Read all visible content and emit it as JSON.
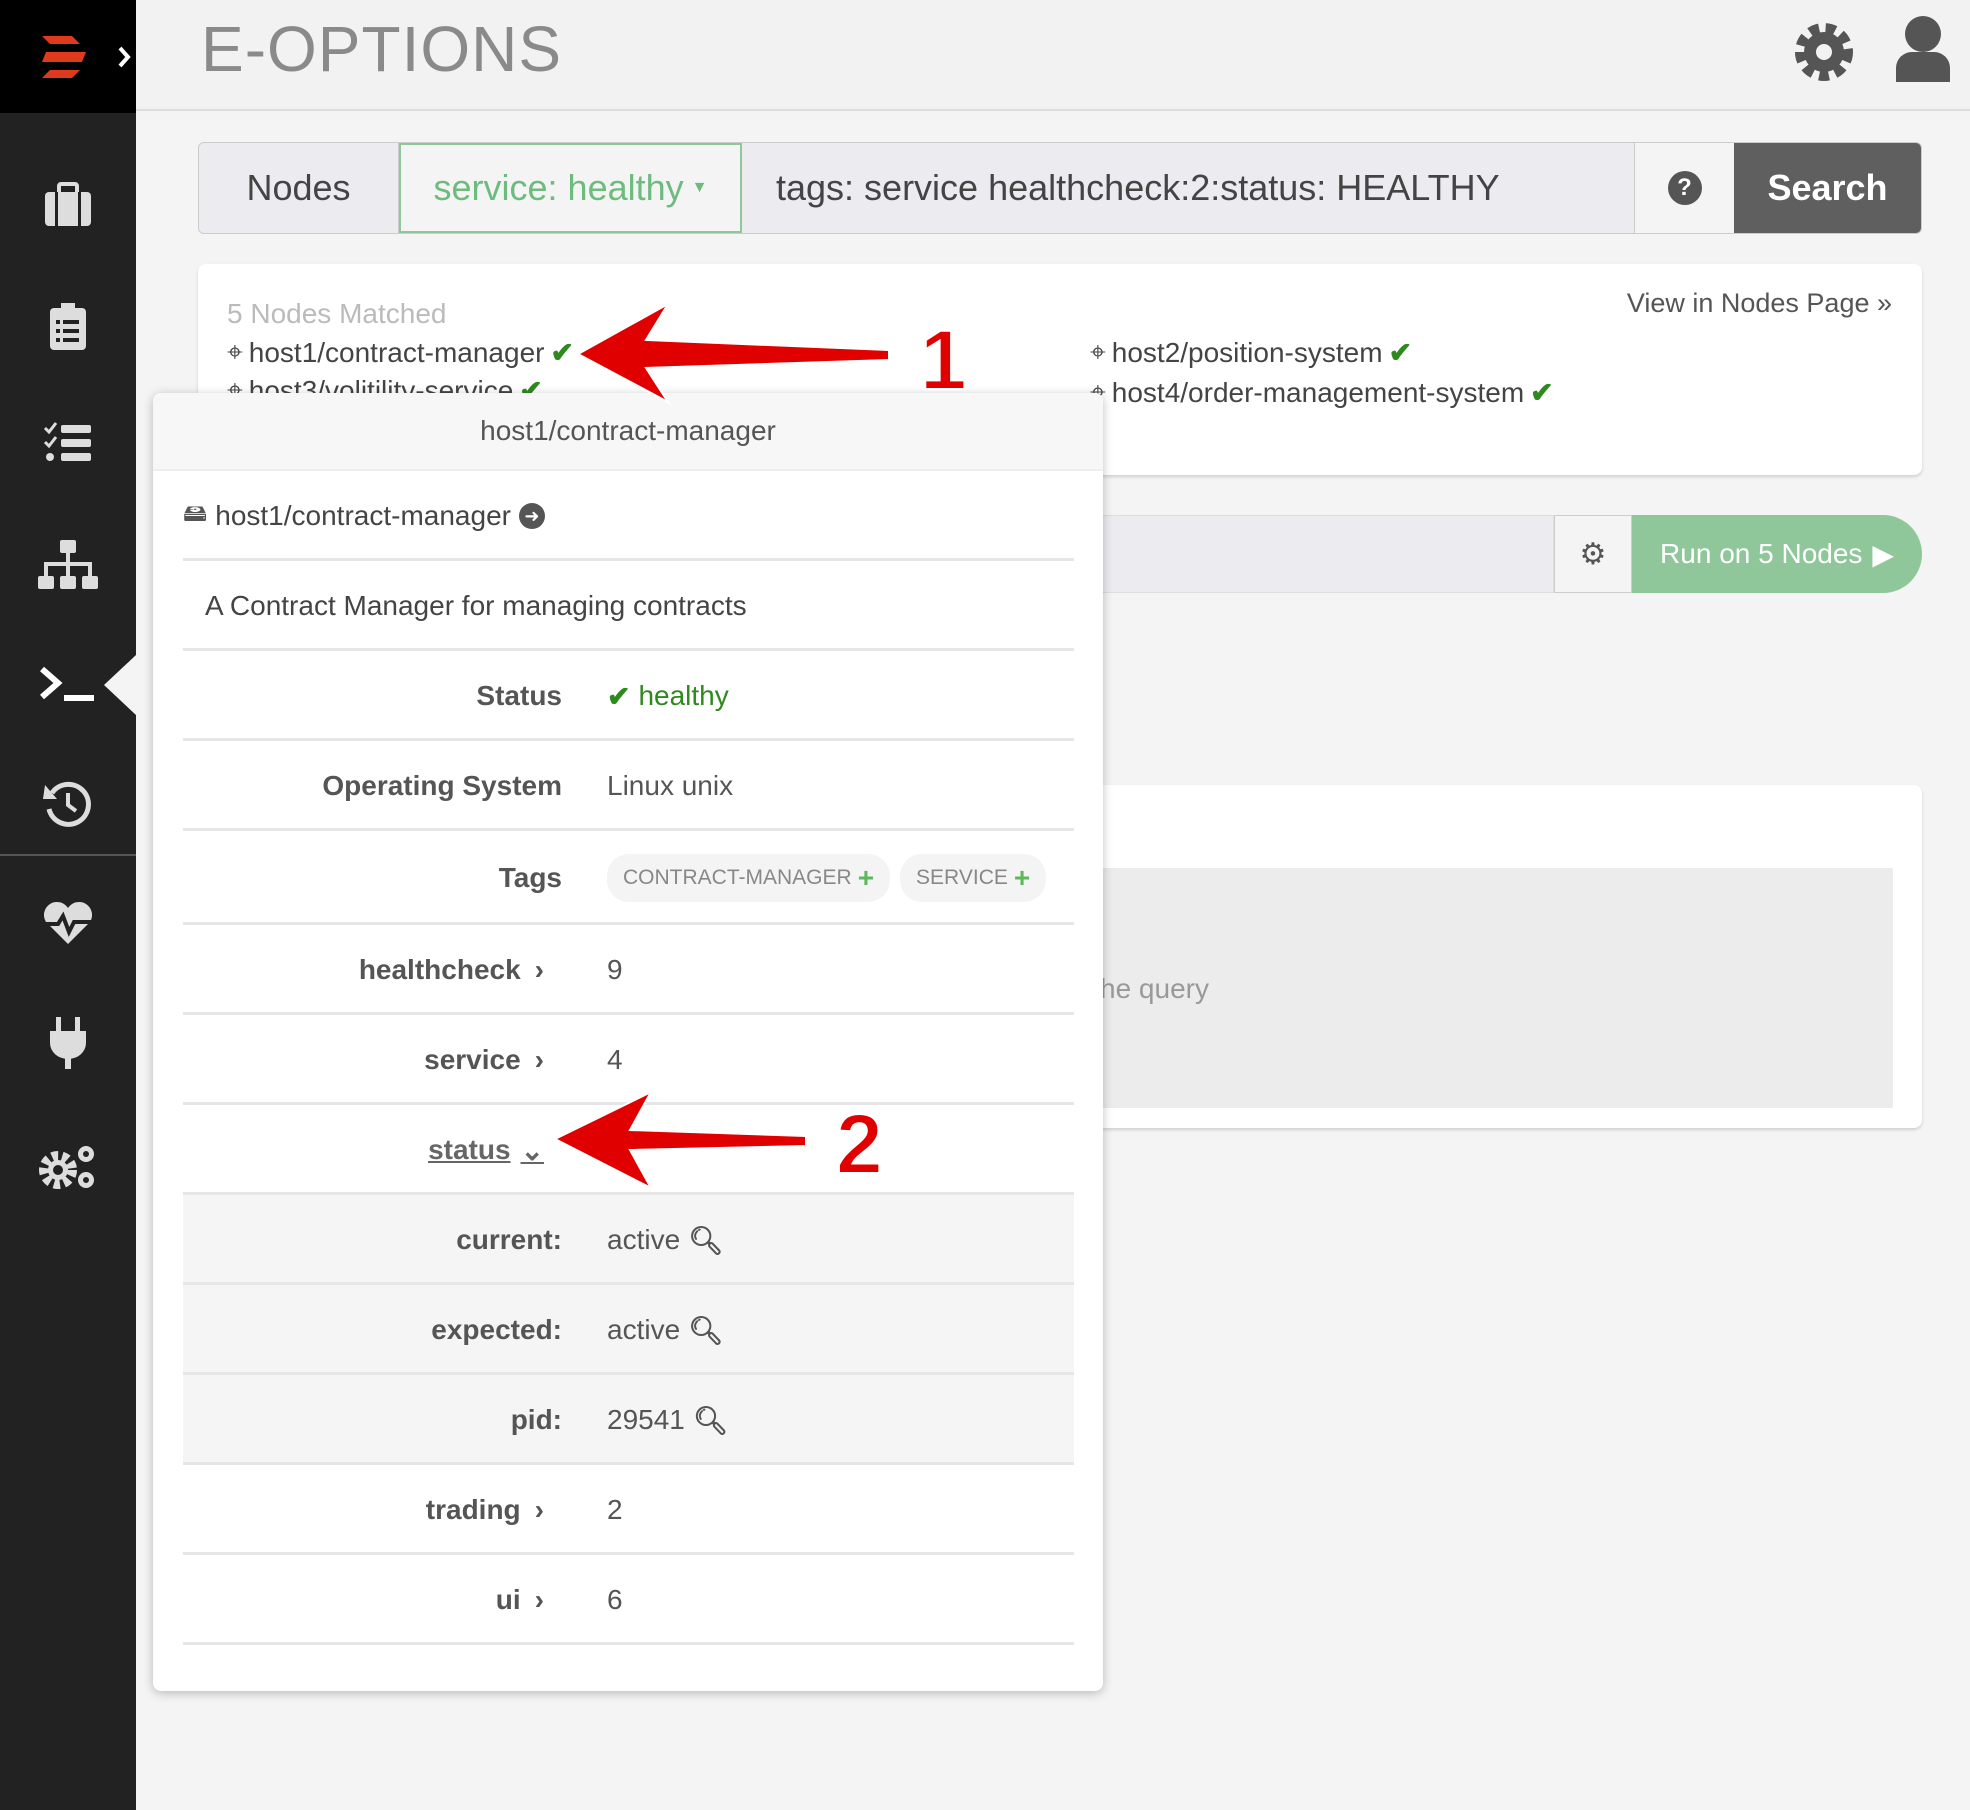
{
  "app": {
    "title": "E-OPTIONS"
  },
  "sidebar": {
    "items": [
      "briefcase-icon",
      "clipboard-icon",
      "tasks-icon",
      "sitemap-icon",
      "terminal-icon",
      "history-icon",
      "heartbeat-icon",
      "plug-icon",
      "cogs-icon"
    ],
    "active": "terminal-icon"
  },
  "search": {
    "mode": "Nodes",
    "filter": "service: healthy",
    "query": "tags: service healthcheck:2:status: HEALTHY",
    "help": "?",
    "button": "Search"
  },
  "results": {
    "count_label": "5 Nodes Matched",
    "view_link": "View in Nodes Page »",
    "nodes": [
      "host1/contract-manager",
      "host3/volitility-service",
      "host2/position-system",
      "host4/order-management-system"
    ]
  },
  "run": {
    "button": "Run on 5 Nodes"
  },
  "output": {
    "hint": "he query"
  },
  "popup": {
    "title": "host1/contract-manager",
    "node_name": "host1/contract-manager",
    "description": "A Contract Manager for managing contracts",
    "status_label": "Status",
    "status_value": "healthy",
    "os_label": "Operating System",
    "os_value": "Linux unix",
    "tags_label": "Tags",
    "tags": [
      "CONTRACT-MANAGER",
      "SERVICE"
    ],
    "groups": [
      {
        "label": "healthcheck",
        "count": "9"
      },
      {
        "label": "service",
        "count": "4"
      },
      {
        "label": "status"
      },
      {
        "label": "trading",
        "count": "2"
      },
      {
        "label": "ui",
        "count": "6"
      }
    ],
    "status_attrs": [
      {
        "label": "current:",
        "value": "active"
      },
      {
        "label": "expected:",
        "value": "active"
      },
      {
        "label": "pid:",
        "value": "29541"
      }
    ]
  },
  "annotations": [
    "1",
    "2"
  ],
  "colors": {
    "accent": "#5cb85c",
    "healthy": "#2e8a1e",
    "arrow": "#e00000",
    "sidebar": "#222222"
  }
}
